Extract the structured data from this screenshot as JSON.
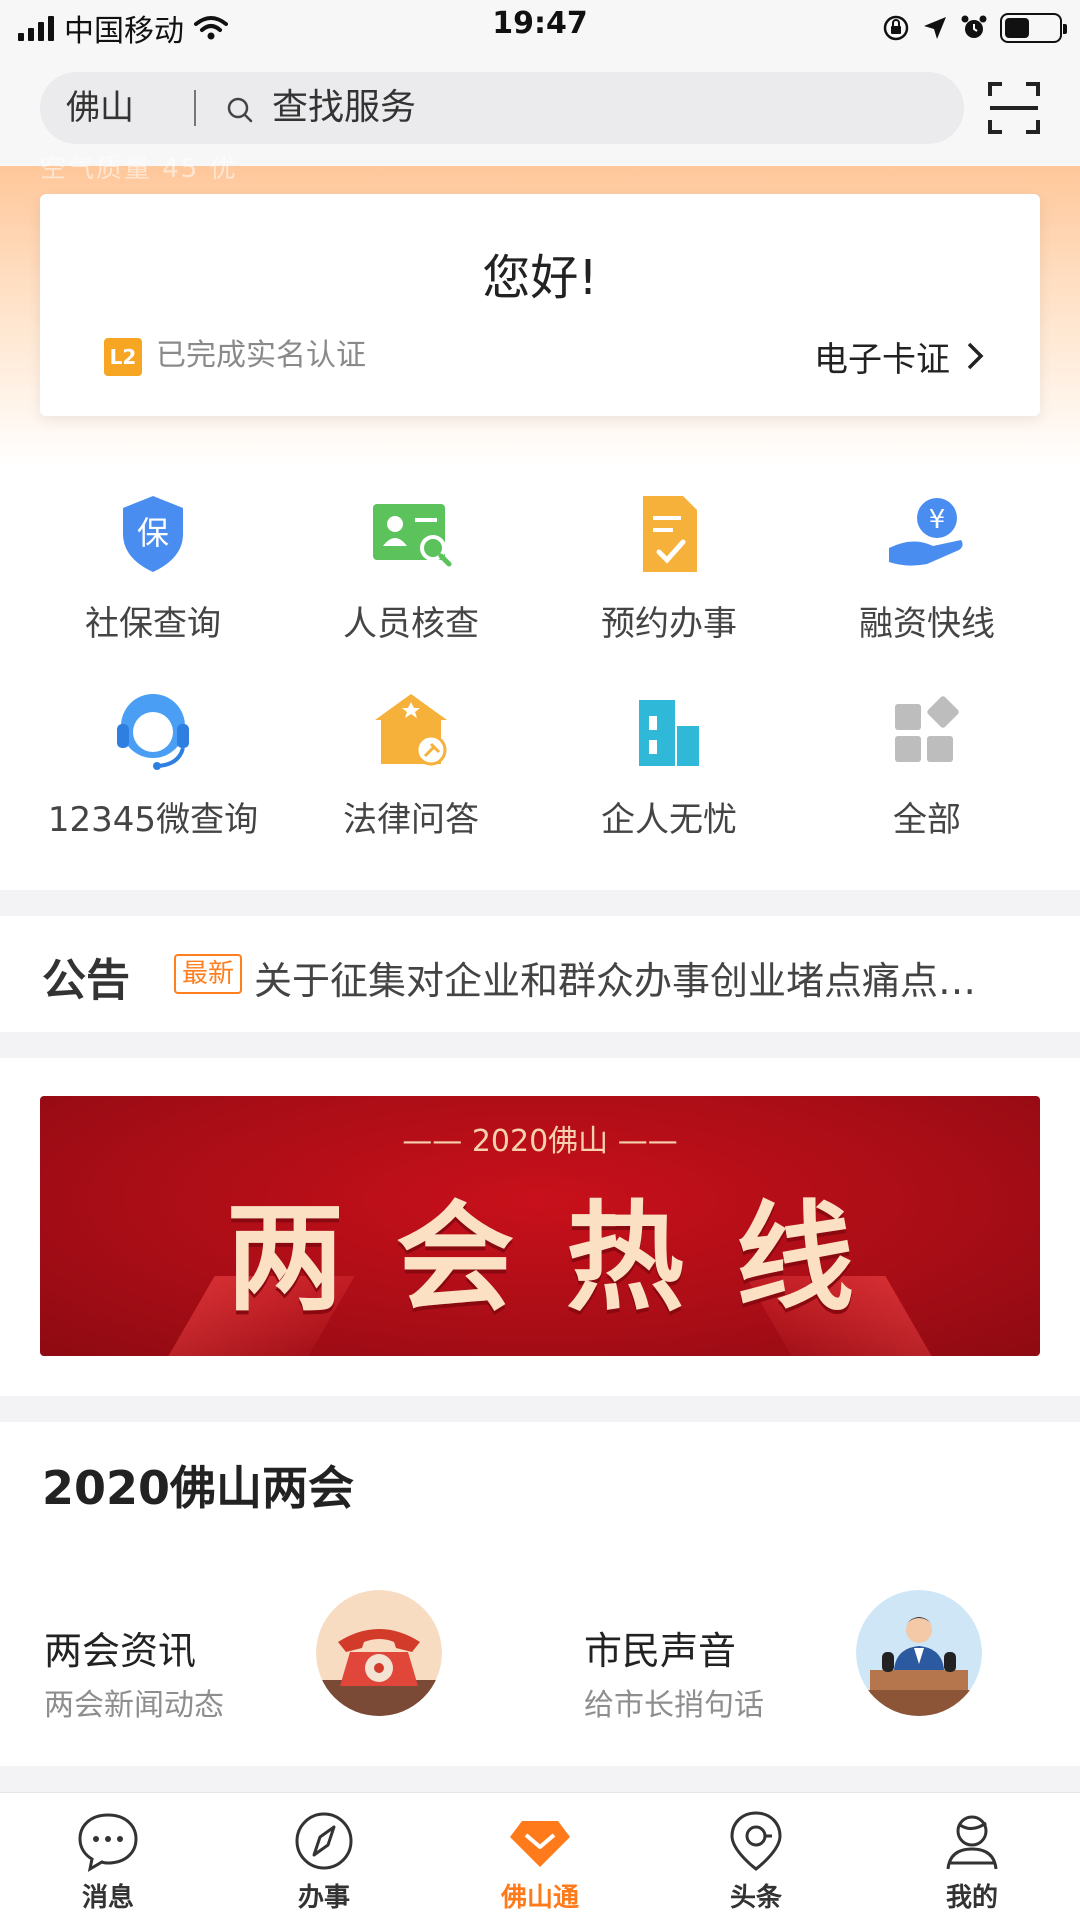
{
  "status_bar": {
    "carrier": "中国移动",
    "time": "19:47"
  },
  "header": {
    "city": "佛山",
    "search_placeholder": "查找服务"
  },
  "hero": {
    "faded_text": "空气质量 45 优"
  },
  "user_card": {
    "greeting": "您好!",
    "level_badge": "L2",
    "verification": "已完成实名认证",
    "ecard_label": "电子卡证"
  },
  "services": [
    {
      "label": "社保查询",
      "icon": "shield-icon"
    },
    {
      "label": "人员核查",
      "icon": "id-search-icon"
    },
    {
      "label": "预约办事",
      "icon": "document-check-icon"
    },
    {
      "label": "融资快线",
      "icon": "hand-coin-icon"
    },
    {
      "label": "12345微查询",
      "icon": "headset-icon"
    },
    {
      "label": "法律问答",
      "icon": "court-icon"
    },
    {
      "label": "企人无忧",
      "icon": "building-icon"
    },
    {
      "label": "全部",
      "icon": "grid-icon"
    }
  ],
  "notice": {
    "title": "公告",
    "tag": "最新",
    "text": "关于征集对企业和群众办事创业堵点痛点…"
  },
  "banner": {
    "subtitle": "—— 2020佛山 ——",
    "title": "两会热线"
  },
  "section": {
    "title": "2020佛山两会",
    "items": [
      {
        "title": "两会资讯",
        "subtitle": "两会新闻动态",
        "icon": "telephone-icon"
      },
      {
        "title": "市民声音",
        "subtitle": "给市长捎句话",
        "icon": "speaker-podium-icon"
      }
    ]
  },
  "tabbar": [
    {
      "label": "消息",
      "icon": "chat-bubble-icon",
      "active": false
    },
    {
      "label": "办事",
      "icon": "compass-icon",
      "active": false
    },
    {
      "label": "佛山通",
      "icon": "diamond-icon",
      "active": true
    },
    {
      "label": "头条",
      "icon": "location-pin-icon",
      "active": false
    },
    {
      "label": "我的",
      "icon": "user-icon",
      "active": false
    }
  ],
  "colors": {
    "accent": "#ff7a1a",
    "banner_red": "#b50d18",
    "badge_orange": "#f6a623"
  }
}
